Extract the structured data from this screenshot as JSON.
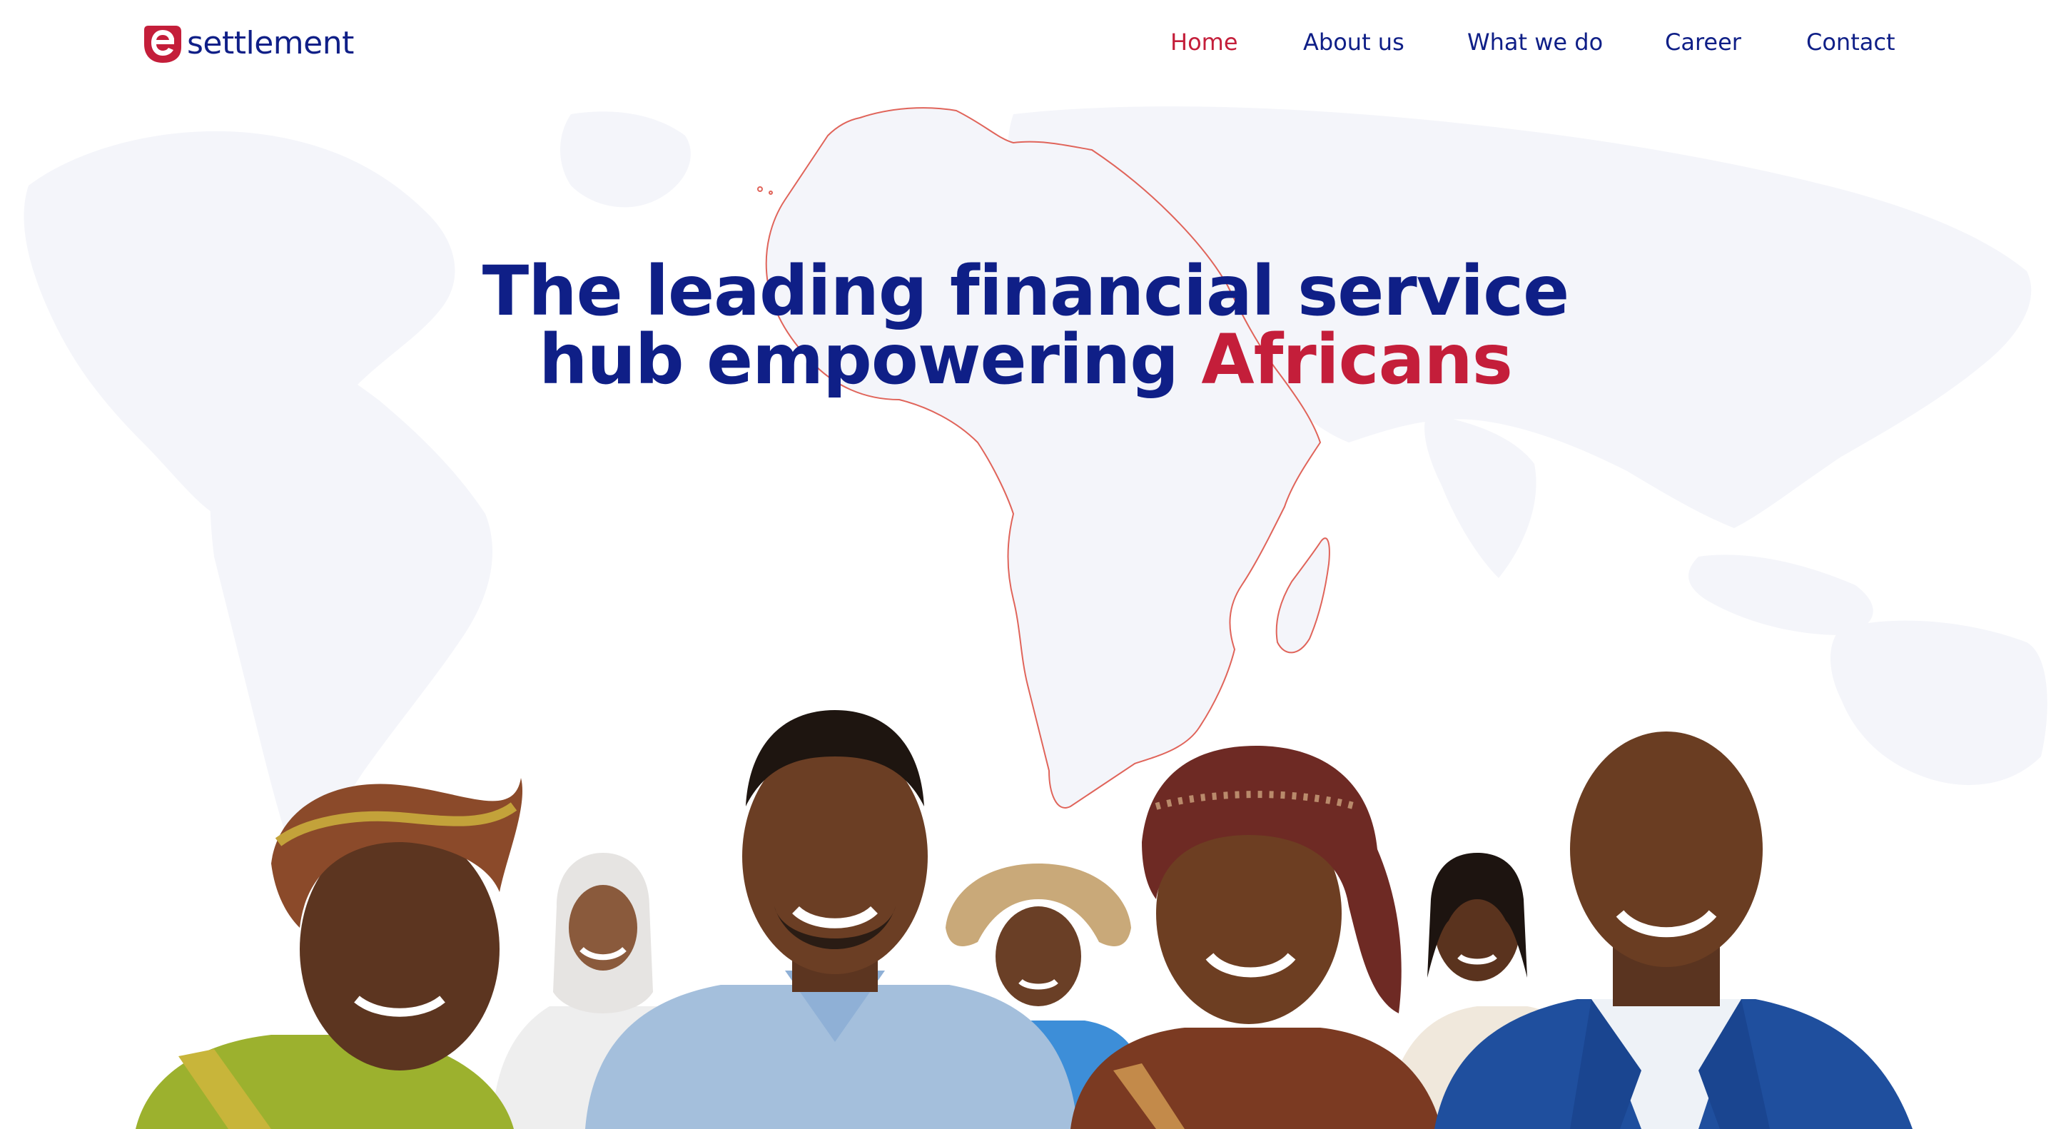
{
  "brand": {
    "name": "settlement",
    "mark_letter": "e",
    "colors": {
      "navy": "#0f1f87",
      "red": "#c41e3a",
      "map_fill": "#f5f6fb",
      "outline": "#e0645a"
    }
  },
  "nav": {
    "items": [
      {
        "label": "Home",
        "active": true
      },
      {
        "label": "About us",
        "active": false
      },
      {
        "label": "What we do",
        "active": false
      },
      {
        "label": "Career",
        "active": false
      },
      {
        "label": "Contact",
        "active": false
      }
    ]
  },
  "hero": {
    "line1": "The leading financial service",
    "line2_prefix": "hub empowering",
    "line2_accent": "Africans"
  },
  "people_collage": {
    "figures": [
      "woman-headwrap-portrait",
      "woman-hijab-portrait",
      "man-denim-shirt-portrait",
      "man-straw-hat-portrait",
      "woman-patterned-headwrap-portrait",
      "woman-braids-portrait",
      "man-blue-suit-portrait"
    ]
  }
}
